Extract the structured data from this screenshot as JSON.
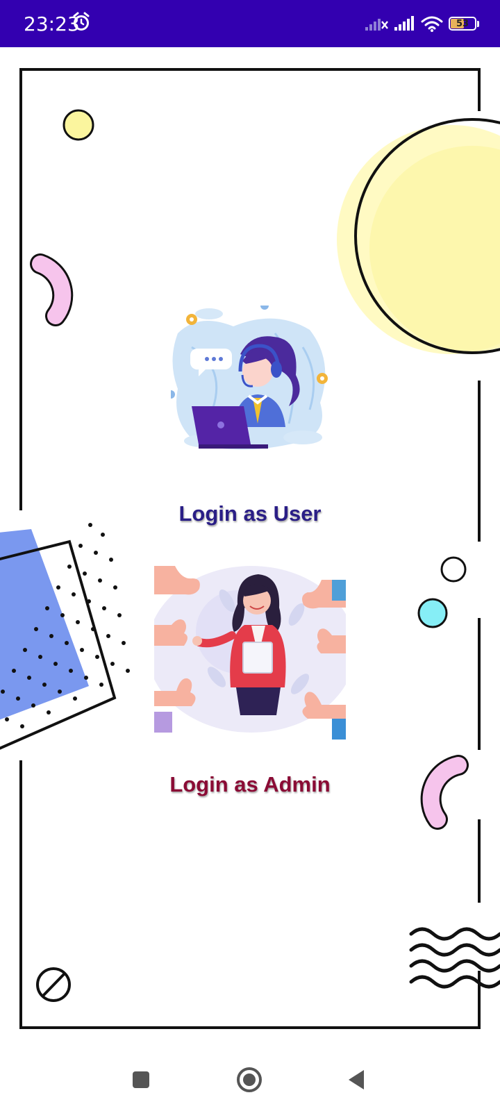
{
  "status_bar": {
    "time": "23:23",
    "battery_percent": "53",
    "icons": [
      "alarm-icon",
      "signal-icon",
      "signal-icon",
      "wifi-icon",
      "battery-icon"
    ]
  },
  "options": {
    "user_label": "Login as User",
    "admin_label": "Login as Admin"
  },
  "colors": {
    "status_bar": "#3300b0",
    "user_label": "#2a1e86",
    "admin_label": "#8a0b35"
  },
  "nav_bar": {
    "icons": [
      "recents-icon",
      "home-icon",
      "back-icon"
    ]
  }
}
